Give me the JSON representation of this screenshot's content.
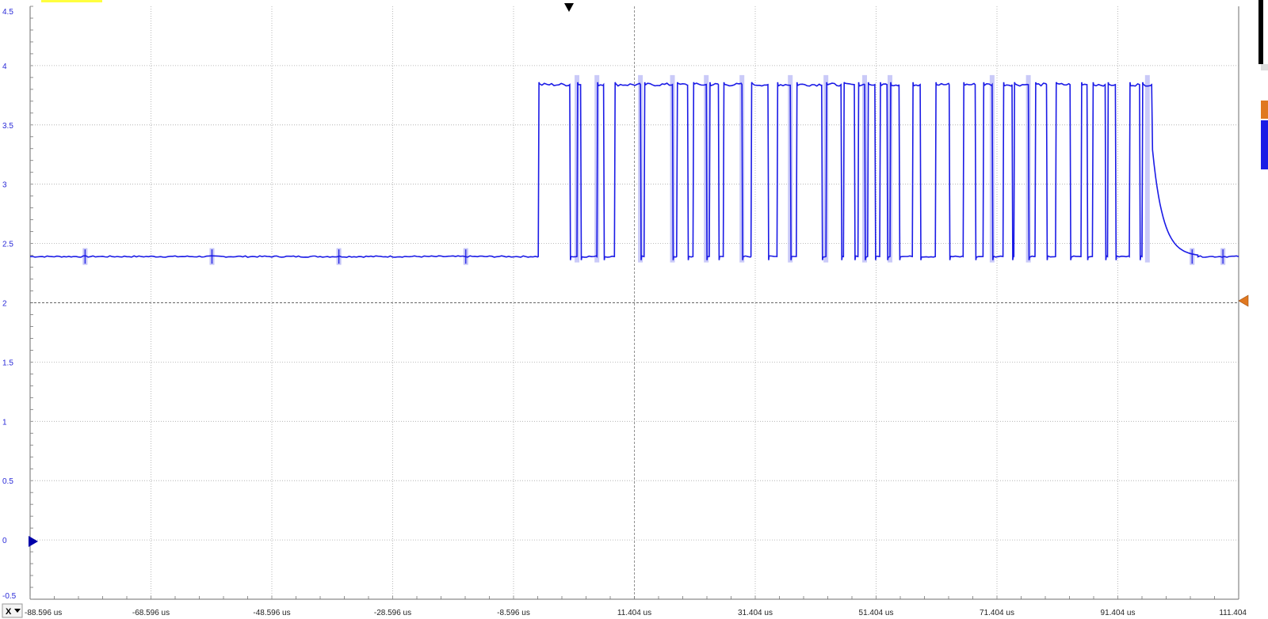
{
  "chart_data": {
    "type": "line",
    "title": "",
    "xlabel": "",
    "ylabel": "",
    "x_unit": "us",
    "x_tick_labels": [
      "-88.596 us",
      "-68.596 us",
      "-48.596 us",
      "-28.596 us",
      "-8.596 us",
      "11.404 us",
      "31.404 us",
      "51.404 us",
      "71.404 us",
      "91.404 us",
      "111.404"
    ],
    "x_ticks": [
      -88.596,
      -68.596,
      -48.596,
      -28.596,
      -8.596,
      11.404,
      31.404,
      51.404,
      71.404,
      91.404,
      111.404
    ],
    "xlim": [
      -88.596,
      111.404
    ],
    "y_tick_labels": [
      "4.5",
      "4",
      "3.5",
      "3",
      "2.5",
      "2",
      "1.5",
      "1",
      "0.5",
      "0",
      "-0.5"
    ],
    "y_ticks": [
      4.5,
      4,
      3.5,
      3,
      2.5,
      2,
      1.5,
      1,
      0.5,
      0,
      -0.5
    ],
    "ylim": [
      -0.5,
      4.5
    ],
    "grid": true,
    "trigger_level": 2.0,
    "trigger_time": 0,
    "series": [
      {
        "color": "#1b1be6",
        "low_level": 2.39,
        "high_level": 3.84,
        "high_pulses_us": [
          [
            -4.5,
            0.7
          ],
          [
            1.9,
            2.5
          ],
          [
            5.2,
            6.3
          ],
          [
            8.1,
            12.4
          ],
          [
            13.0,
            17.7
          ],
          [
            18.4,
            20.2
          ],
          [
            21.1,
            23.3
          ],
          [
            23.8,
            25.3
          ],
          [
            26.1,
            29.2
          ],
          [
            30.7,
            33.5
          ],
          [
            35.0,
            37.2
          ],
          [
            38.2,
            42.4
          ],
          [
            43.1,
            45.6
          ],
          [
            46.0,
            47.8
          ],
          [
            48.4,
            49.5
          ],
          [
            50.0,
            51.2
          ],
          [
            52.0,
            53.2
          ],
          [
            53.7,
            55.2
          ],
          [
            57.4,
            58.7
          ],
          [
            61.2,
            63.5
          ],
          [
            65.8,
            67.8
          ],
          [
            69.1,
            70.6
          ],
          [
            72.4,
            73.9
          ],
          [
            74.2,
            76.6
          ],
          [
            77.7,
            79.6
          ],
          [
            81.1,
            83.5
          ],
          [
            85.3,
            86.3
          ],
          [
            87.2,
            89.3
          ],
          [
            89.7,
            91.0
          ],
          [
            93.3,
            95.0
          ],
          [
            95.4,
            97.0
          ]
        ],
        "glitch_times_us": [
          -79.5,
          -58.5,
          -37.5,
          -16.5,
          108.8,
          103.7
        ]
      }
    ],
    "colors": {
      "trace": "#1b1be6",
      "highlight": "#b8b8f5",
      "grid": "#999999",
      "trigger_marker": "#e07820",
      "offset_marker": "#0000aa"
    }
  },
  "controls": {
    "x_button_label": "X"
  }
}
